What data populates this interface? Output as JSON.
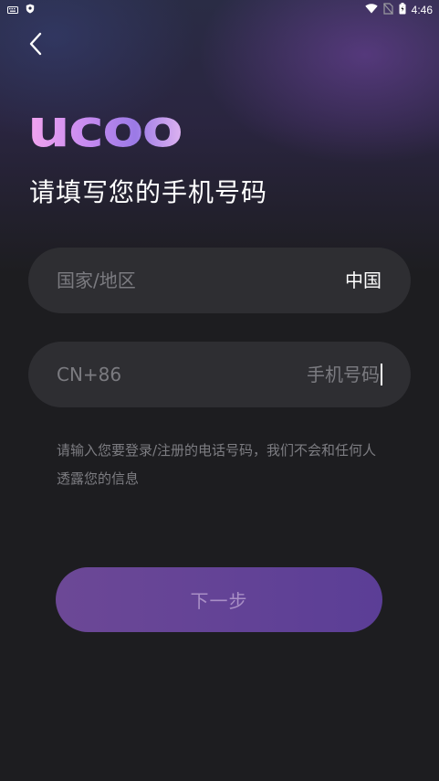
{
  "status_bar": {
    "time": "4:46",
    "left_icons": [
      "keyboard-icon",
      "shield-icon"
    ],
    "right_icons": [
      "wifi-icon",
      "no-sim-icon",
      "battery-icon"
    ]
  },
  "header": {
    "back_icon": "chevron-left-icon"
  },
  "brand": {
    "logo_text": "ucoo"
  },
  "page": {
    "title": "请填写您的手机号码"
  },
  "country_field": {
    "label": "国家/地区",
    "value": "中国"
  },
  "phone_field": {
    "prefix": "CN+86",
    "placeholder": "手机号码",
    "value": ""
  },
  "hint": {
    "text": "请输入您要登录/注册的电话号码，我们不会和任何人透露您的信息"
  },
  "actions": {
    "next_label": "下一步"
  },
  "colors": {
    "background": "#1d1d20",
    "field_background": "#2e2e32",
    "button_gradient_start": "#6c4896",
    "button_gradient_end": "#5b3e96",
    "button_text": "#a98fc6",
    "muted_text": "#7b7b80",
    "logo_gradient": [
      "#f3a5ef",
      "#c58af0",
      "#9b7ae6",
      "#ddb2f0"
    ]
  }
}
